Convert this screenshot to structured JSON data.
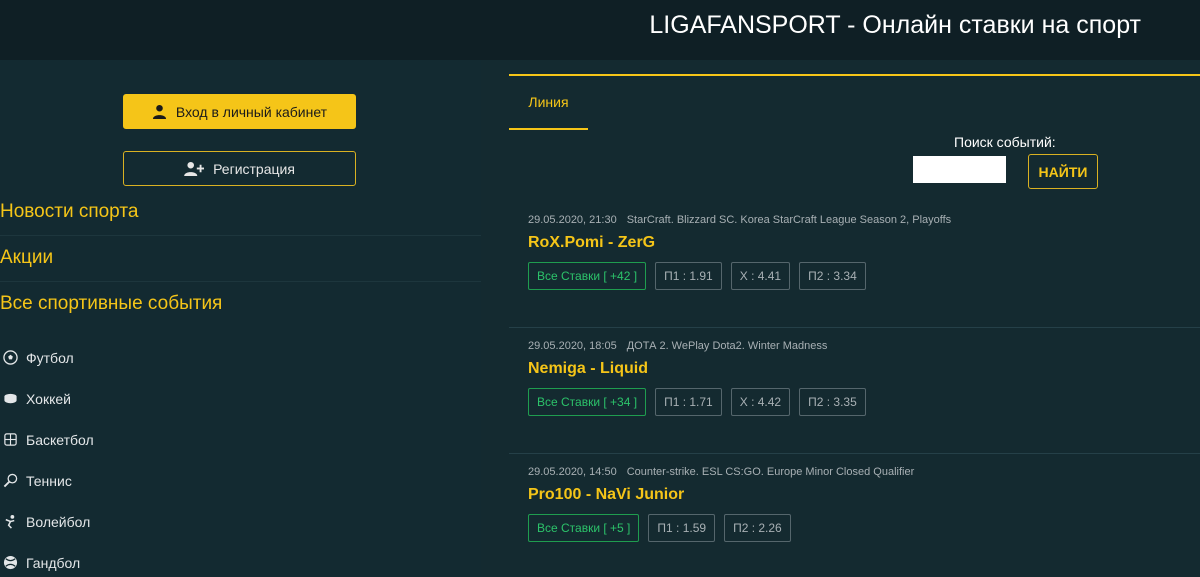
{
  "header": {
    "title": "LIGAFANSPORT - Онлайн ставки на спорт"
  },
  "sidebar": {
    "login_label": "Вход в личный кабинет",
    "register_label": "Регистрация",
    "nav": [
      "Новости спорта",
      "Акции",
      "Все спортивные события"
    ],
    "sports": [
      {
        "label": "Футбол",
        "icon": "soccer-ball-icon"
      },
      {
        "label": "Хоккей",
        "icon": "hockey-puck-icon"
      },
      {
        "label": "Баскетбол",
        "icon": "basketball-icon"
      },
      {
        "label": "Теннис",
        "icon": "tennis-racket-icon"
      },
      {
        "label": "Волейбол",
        "icon": "volleyball-icon"
      },
      {
        "label": "Гандбол",
        "icon": "handball-icon"
      }
    ]
  },
  "main": {
    "tab_label": "Линия",
    "search": {
      "label": "Поиск событий:",
      "value": "",
      "button_label": "НАЙТИ"
    },
    "events": [
      {
        "datetime": "29.05.2020, 21:30",
        "league": "StarCraft. Blizzard SC. Korea StarCraft League Season 2, Playoffs",
        "teams": "RoX.Pomi - ZerG",
        "all_bets": "Все Ставки [ +42 ]",
        "odds": [
          "П1 : 1.91",
          "X : 4.41",
          "П2 : 3.34"
        ]
      },
      {
        "datetime": "29.05.2020, 18:05",
        "league": "ДОТА 2. WePlay Dota2. Winter Madness",
        "teams": "Nemiga - Liquid",
        "all_bets": "Все Ставки [ +34 ]",
        "odds": [
          "П1 : 1.71",
          "X : 4.42",
          "П2 : 3.35"
        ]
      },
      {
        "datetime": "29.05.2020, 14:50",
        "league": "Counter-strike. ESL CS:GO. Europe Minor Closed Qualifier",
        "teams": "Pro100 - NaVi Junior",
        "all_bets": "Все Ставки [ +5 ]",
        "odds": [
          "П1 : 1.59",
          "П2 : 2.26"
        ]
      }
    ]
  },
  "colors": {
    "accent": "#f5c518",
    "background": "#142a30",
    "header": "#0f1f25",
    "positive": "#2cc36a"
  }
}
